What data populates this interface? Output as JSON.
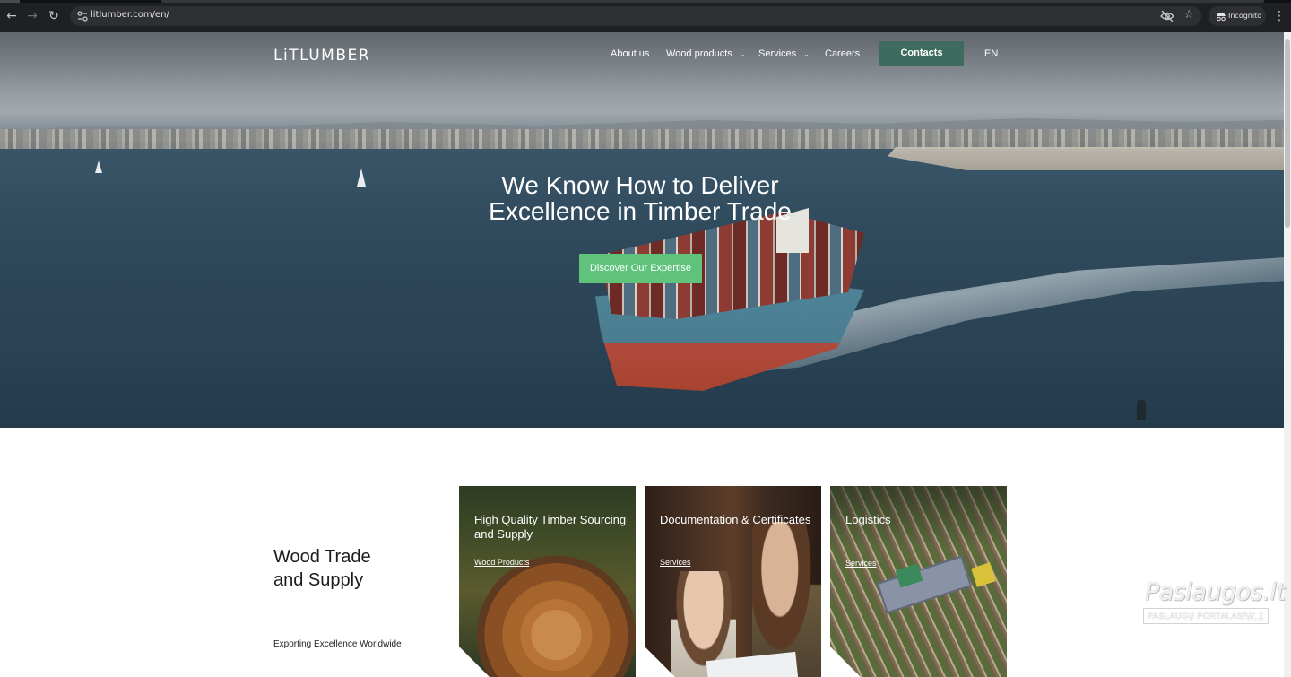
{
  "browser": {
    "url": "litlumber.com/en/",
    "profile_label": "Incognito",
    "icons": {
      "back": "back-arrow-icon",
      "forward": "forward-arrow-icon",
      "reload": "reload-icon",
      "site_info": "site-info-icon",
      "eye_off": "eye-off-icon",
      "bookmark": "star-icon",
      "incognito": "incognito-icon",
      "menu": "kebab-menu-icon"
    }
  },
  "site": {
    "logo": "LiTLUMBER",
    "nav": {
      "about": "About us",
      "wood_products": "Wood products",
      "services": "Services",
      "careers": "Careers",
      "contacts": "Contacts",
      "language": "EN"
    },
    "hero": {
      "title_line1": "We Know How to Deliver",
      "title_line2": "Excellence in Timber Trade",
      "cta": "Discover Our Expertise"
    },
    "section": {
      "title_line1": "Wood Trade",
      "title_line2": "and Supply",
      "subtitle": "Exporting Excellence Worldwide"
    },
    "cards": [
      {
        "title": "High Quality Timber Sourcing and Supply",
        "link": "Wood Products"
      },
      {
        "title": "Documentation & Certificates",
        "link": "Services"
      },
      {
        "title": "Logistics",
        "link": "Services"
      }
    ]
  },
  "watermark": {
    "brand": "Paslaugos.lt",
    "tagline": "PASLAUGŲ PORTALAS",
    "rank": "Nr.1"
  },
  "colors": {
    "accent_green": "#5fc37c",
    "contacts_bg": "#3d6b5e",
    "chrome_bg": "#1f2023"
  }
}
